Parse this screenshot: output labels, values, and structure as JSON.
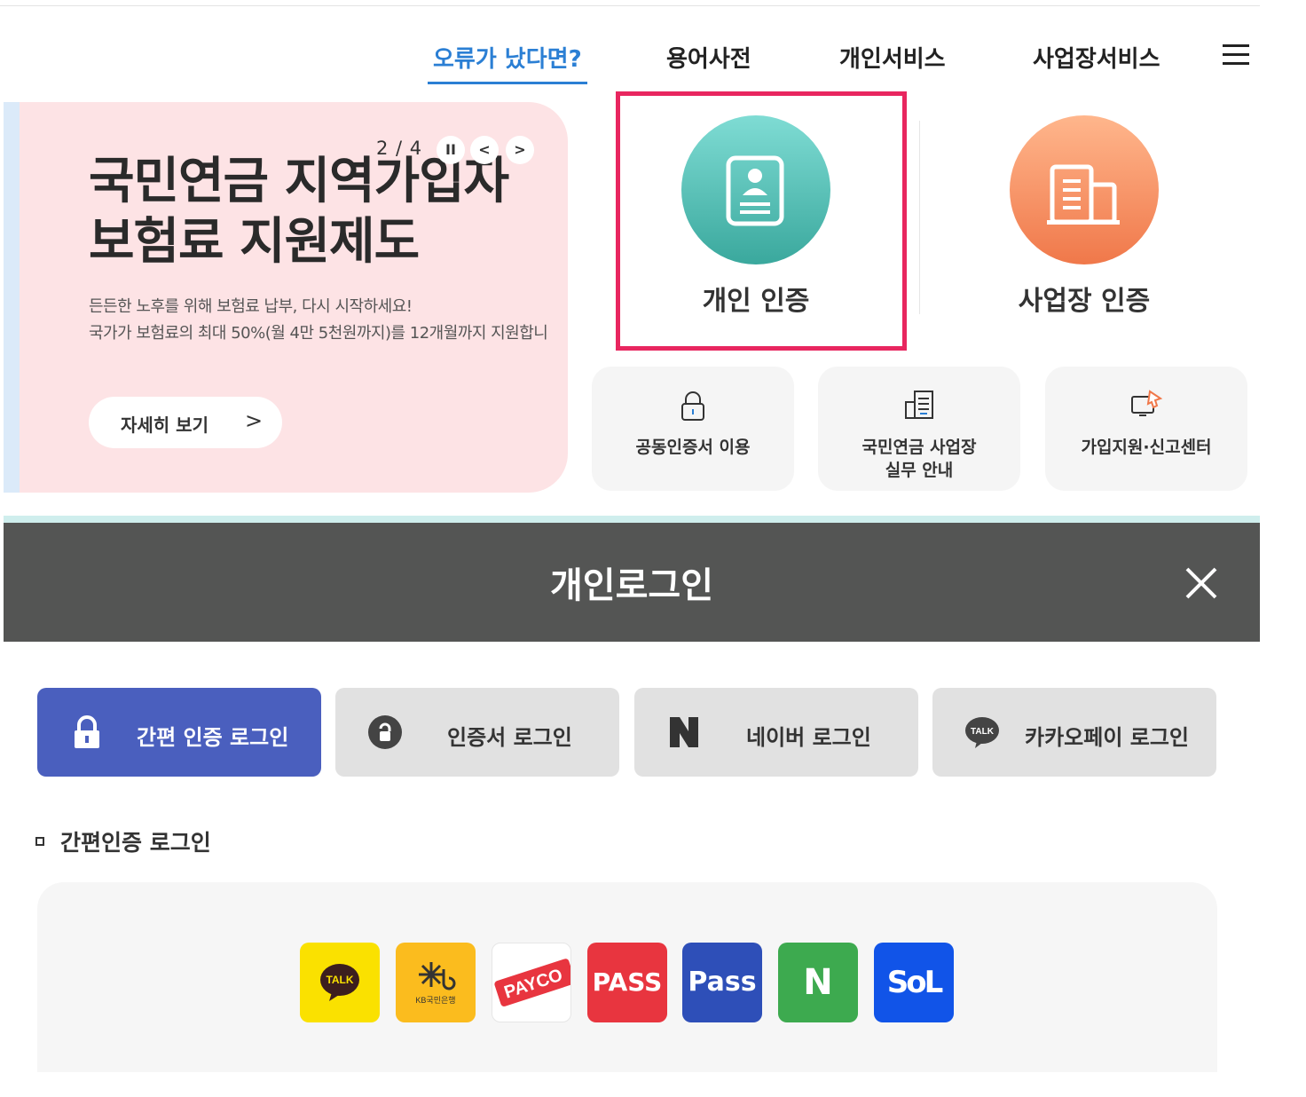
{
  "nav": {
    "items": [
      {
        "label": "오류가 났다면?",
        "active": true
      },
      {
        "label": "용어사전",
        "active": false
      },
      {
        "label": "개인서비스",
        "active": false
      },
      {
        "label": "사업장서비스",
        "active": false
      }
    ],
    "menu_icon": "hamburger-menu-icon"
  },
  "banner": {
    "title_line1": "국민연금 지역가입자",
    "title_line2": "보험료 지원제도",
    "desc_line1": "든든한 노후를 위해 보험료 납부, 다시 시작하세요!",
    "desc_line2": "국가가 보험료의 최대 50%(월 4만 5천원까지)를 12개월까지 지원합니",
    "button_label": "자세히 보기",
    "button_chevron": ">",
    "pager": "2 / 4",
    "pause_glyph": "II",
    "prev_glyph": "<",
    "next_glyph": ">",
    "background_color": "#fde3e5"
  },
  "auth": {
    "personal_label": "개인 인증",
    "business_label": "사업장 인증",
    "highlight_color": "#e8265f"
  },
  "tiles": [
    {
      "label_line1": "공동인증서 이용",
      "label_line2": "",
      "icon": "lock-icon"
    },
    {
      "label_line1": "국민연금 사업장",
      "label_line2": "실무 안내",
      "icon": "document-building-icon"
    },
    {
      "label_line1": "가입지원·신고센터",
      "label_line2": "",
      "icon": "monitor-pointer-icon"
    }
  ],
  "login": {
    "title": "개인로그인",
    "close_icon": "close-icon",
    "tabs": [
      {
        "label": "간편 인증 로그인",
        "active": true,
        "icon": "padlock-icon"
      },
      {
        "label": "인증서 로그인",
        "active": false,
        "icon": "certificate-icon"
      },
      {
        "label": "네이버 로그인",
        "active": false,
        "icon": "naver-n-icon"
      },
      {
        "label": "카카오페이 로그인",
        "active": false,
        "icon": "kakao-talk-icon"
      }
    ],
    "section_title": "간편인증 로그인",
    "providers": [
      {
        "label": "TALK",
        "color": "#fae100"
      },
      {
        "label": "KB국민은행",
        "color": "#fbbc1e"
      },
      {
        "label": "PAYCO",
        "color": "#ffffff"
      },
      {
        "label": "PASS",
        "color": "#e8353f"
      },
      {
        "label": "Pass",
        "color": "#2e4fb8"
      },
      {
        "label": "N",
        "color": "#3daa4f"
      },
      {
        "label": "SoL",
        "color": "#1154e8"
      }
    ],
    "tab_active_color": "#4a5fbe"
  }
}
